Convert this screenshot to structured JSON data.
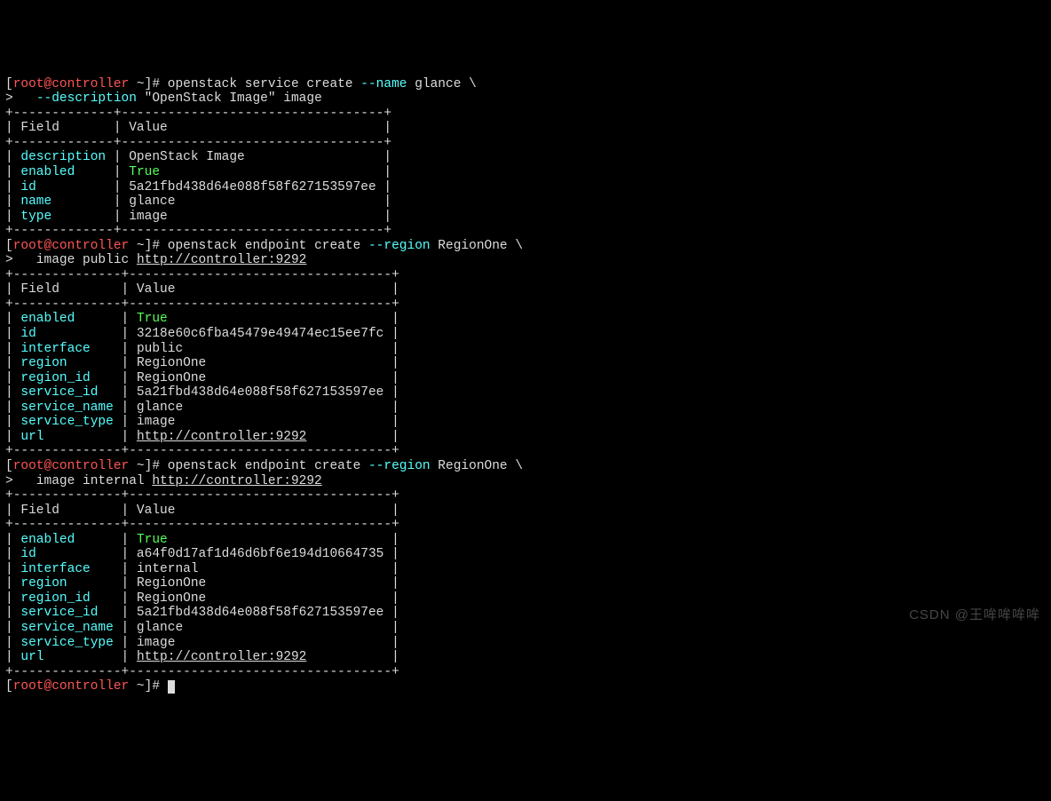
{
  "prompt1": {
    "line1_pre": "[",
    "line1_red": "root@controller",
    "line1_mid": " ~]# openstack service create ",
    "line1_cyan": "--name",
    "line1_post": " glance \\",
    "line2_pre": ">   ",
    "line2_cyan": "--description",
    "line2_post": " \"OpenStack Image\" image"
  },
  "table1": {
    "border": "+-------------+----------------------------------+",
    "header": "| Field       | Value                            |",
    "rows": {
      "r0_f": "| ",
      "r0_fv": "description",
      "r0_m": " | OpenStack Image                  |",
      "r1_f": "| ",
      "r1_fv": "enabled",
      "r1_m": "     | ",
      "r1_v": "True",
      "r1_e": "                             |",
      "r2_f": "| ",
      "r2_fv": "id",
      "r2_m": "          | 5a21fbd438d64e088f58f627153597ee |",
      "r3_f": "| ",
      "r3_fv": "name",
      "r3_m": "        | glance                           |",
      "r4_f": "| ",
      "r4_fv": "type",
      "r4_m": "        | image                            |"
    }
  },
  "prompt2": {
    "line1_pre": "[",
    "line1_red": "root@controller",
    "line1_mid": " ~]# openstack endpoint create ",
    "line1_cyan": "--region",
    "line1_post": " RegionOne \\",
    "line2_pre": ">   image public ",
    "line2_url": "http://controller:9292"
  },
  "table2": {
    "border": "+--------------+----------------------------------+",
    "header": "| Field        | Value                            |",
    "rows": {
      "r0_f": "| ",
      "r0_fv": "enabled",
      "r0_m": "      | ",
      "r0_v": "True",
      "r0_e": "                             |",
      "r1_f": "| ",
      "r1_fv": "id",
      "r1_m": "           | 3218e60c6fba45479e49474ec15ee7fc |",
      "r2_f": "| ",
      "r2_fv": "interface",
      "r2_m": "    | public                           |",
      "r3_f": "| ",
      "r3_fv": "region",
      "r3_m": "       | RegionOne                        |",
      "r4_f": "| ",
      "r4_fv": "region_id",
      "r4_m": "    | RegionOne                        |",
      "r5_f": "| ",
      "r5_fv": "service_id",
      "r5_m": "   | 5a21fbd438d64e088f58f627153597ee |",
      "r6_f": "| ",
      "r6_fv": "service_name",
      "r6_m": " | glance                           |",
      "r7_f": "| ",
      "r7_fv": "service_type",
      "r7_m": " | image                            |",
      "r8_f": "| ",
      "r8_fv": "url",
      "r8_m": "          | ",
      "r8_v": "http://controller:9292",
      "r8_e": "           |"
    }
  },
  "prompt3": {
    "line1_pre": "[",
    "line1_red": "root@controller",
    "line1_mid": " ~]# openstack endpoint create ",
    "line1_cyan": "--region",
    "line1_post": " RegionOne \\",
    "line2_pre": ">   image internal ",
    "line2_url": "http://controller:9292"
  },
  "table3": {
    "border": "+--------------+----------------------------------+",
    "header": "| Field        | Value                            |",
    "rows": {
      "r0_f": "| ",
      "r0_fv": "enabled",
      "r0_m": "      | ",
      "r0_v": "True",
      "r0_e": "                             |",
      "r1_f": "| ",
      "r1_fv": "id",
      "r1_m": "           | a64f0d17af1d46d6bf6e194d10664735 |",
      "r2_f": "| ",
      "r2_fv": "interface",
      "r2_m": "    | internal                         |",
      "r3_f": "| ",
      "r3_fv": "region",
      "r3_m": "       | RegionOne                        |",
      "r4_f": "| ",
      "r4_fv": "region_id",
      "r4_m": "    | RegionOne                        |",
      "r5_f": "| ",
      "r5_fv": "service_id",
      "r5_m": "   | 5a21fbd438d64e088f58f627153597ee |",
      "r6_f": "| ",
      "r6_fv": "service_name",
      "r6_m": " | glance                           |",
      "r7_f": "| ",
      "r7_fv": "service_type",
      "r7_m": " | image                            |",
      "r8_f": "| ",
      "r8_fv": "url",
      "r8_m": "          | ",
      "r8_v": "http://controller:9292",
      "r8_e": "           |"
    }
  },
  "prompt4": {
    "pre": "[",
    "red": "root@controller",
    "post": " ~]# "
  },
  "watermark": "CSDN @王哞哞哞哞"
}
